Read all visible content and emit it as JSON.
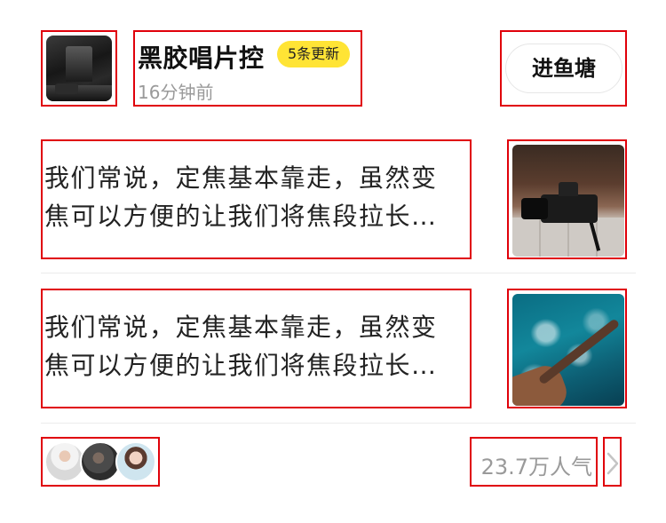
{
  "header": {
    "avatar_icon": "album-cover-image",
    "title": "黑胶唱片控",
    "badge": "5条更新",
    "time": "16分钟前",
    "enter_button": "进鱼塘"
  },
  "posts": [
    {
      "lines": [
        "我们常说，定焦基本靠走，虽然变",
        "焦可以方便的让我们将焦段拉长…"
      ],
      "thumbnail": "camera-photo"
    },
    {
      "lines": [
        "我们常说，定焦基本靠走，虽然变",
        "焦可以方便的让我们将焦段拉长…"
      ],
      "thumbnail": "ocean-aerial-photo"
    }
  ],
  "footer": {
    "member_avatars": [
      "member-avatar-1",
      "member-avatar-2",
      "member-avatar-3"
    ],
    "popularity": "23.7万人气",
    "more_icon": "chevron-right-icon"
  },
  "colors": {
    "badge_bg": "#ffe435",
    "muted_text": "#9a9a9a",
    "annotation_border": "#e0000a"
  }
}
